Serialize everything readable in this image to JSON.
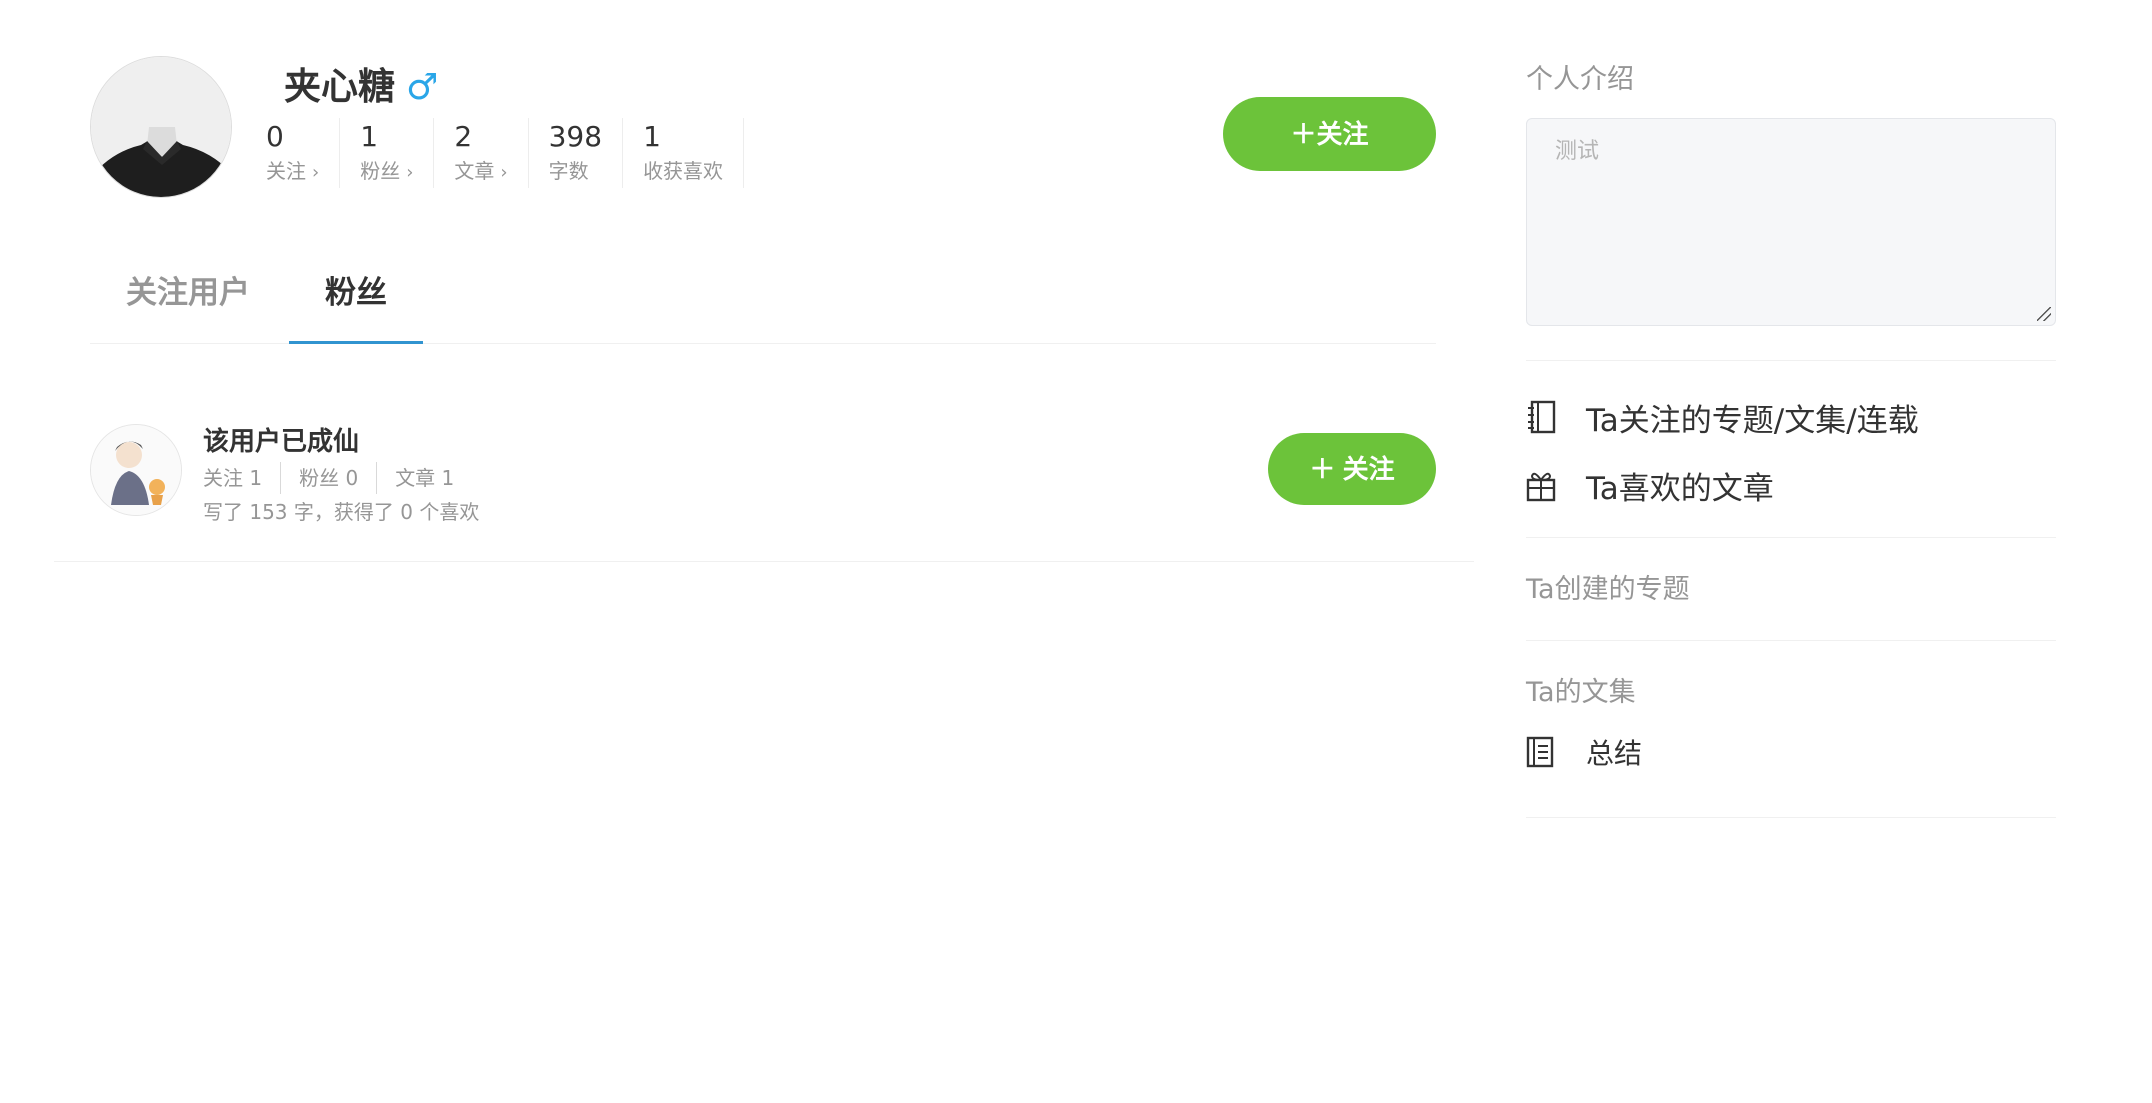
{
  "profile": {
    "name": "夹心糖",
    "gender_symbol": "♂",
    "stats": [
      {
        "value": "0",
        "label": "关注",
        "chevron": "›"
      },
      {
        "value": "1",
        "label": "粉丝",
        "chevron": "›"
      },
      {
        "value": "2",
        "label": "文章",
        "chevron": "›"
      },
      {
        "value": "398",
        "label": "字数",
        "chevron": ""
      },
      {
        "value": "1",
        "label": "收获喜欢",
        "chevron": ""
      }
    ],
    "follow_button": "＋关注"
  },
  "tabs": {
    "following": "关注用户",
    "fans": "粉丝"
  },
  "follower_list": [
    {
      "name": "该用户已成仙",
      "following": "关注 1",
      "fans": "粉丝 0",
      "articles": "文章 1",
      "summary": "写了 153 字，获得了 0 个喜欢",
      "follow_button": "＋ 关注"
    }
  ],
  "sidebar": {
    "intro_title": "个人介绍",
    "intro_value": "测试",
    "links": [
      {
        "label": "Ta关注的专题/文集/连载",
        "icon": "notebook-icon"
      },
      {
        "label": "Ta喜欢的文章",
        "icon": "gift-icon"
      }
    ],
    "created_topics_title": "Ta创建的专题",
    "collections_title": "Ta的文集",
    "collections": [
      {
        "label": "总结",
        "icon": "book-icon"
      }
    ]
  },
  "colors": {
    "accent_green": "#6cc33a",
    "tab_underline": "#3194d0",
    "gender_blue": "#2aa6e8",
    "muted_text": "#969696"
  }
}
